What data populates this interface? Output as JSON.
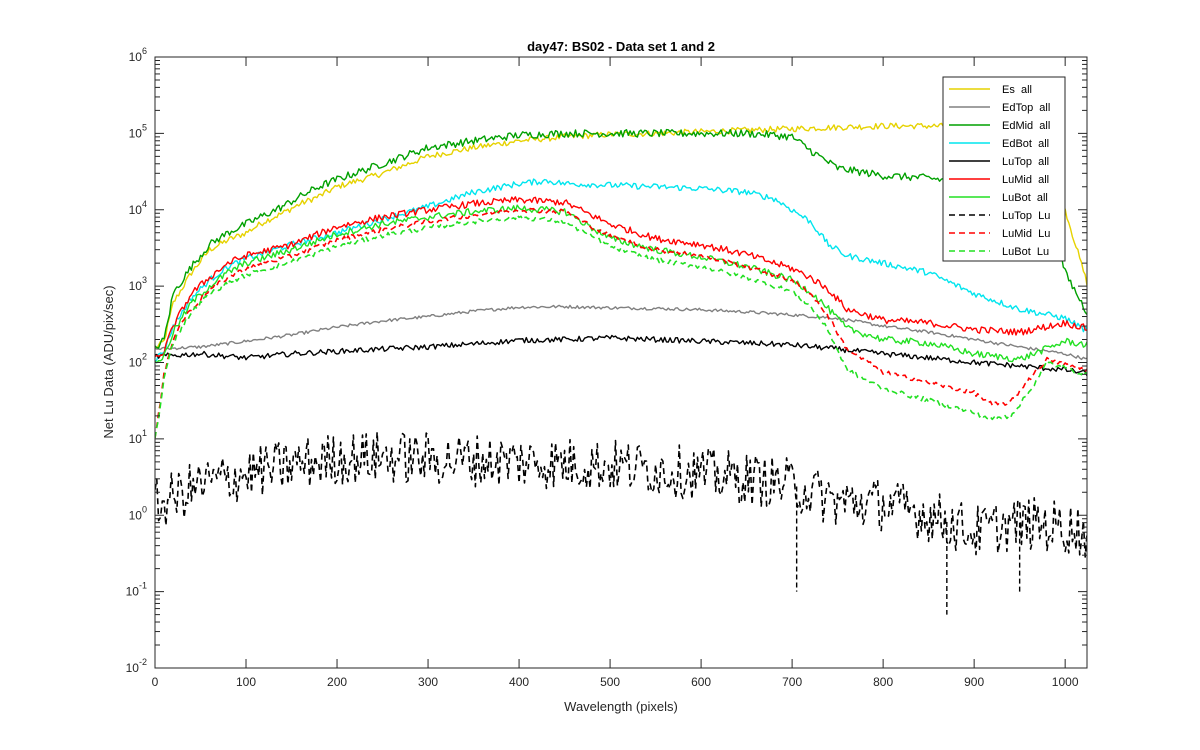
{
  "chart_data": {
    "type": "line",
    "title": "day47: BS02 - Data set 1 and 2",
    "xlabel": "Wavelength (pixels)",
    "ylabel": "Net Lu Data (ADU/pix/sec)",
    "xlim": [
      0,
      1024
    ],
    "ylim": [
      0.01,
      1000000
    ],
    "yscale": "log",
    "grid": false,
    "legend_position": "top-right",
    "x_ticks": [
      0,
      100,
      200,
      300,
      400,
      500,
      600,
      700,
      800,
      900,
      1000
    ],
    "x_tick_labels": [
      "0",
      "100",
      "200",
      "300",
      "400",
      "500",
      "600",
      "700",
      "800",
      "900",
      "1000"
    ],
    "y_ticks": [
      0.01,
      0.1,
      1,
      10,
      100,
      1000,
      10000,
      100000,
      1000000
    ],
    "y_tick_labels": [
      {
        "base": "10",
        "exp": "-2"
      },
      {
        "base": "10",
        "exp": "-1"
      },
      {
        "base": "10",
        "exp": "0"
      },
      {
        "base": "10",
        "exp": "1"
      },
      {
        "base": "10",
        "exp": "2"
      },
      {
        "base": "10",
        "exp": "3"
      },
      {
        "base": "10",
        "exp": "4"
      },
      {
        "base": "10",
        "exp": "5"
      },
      {
        "base": "10",
        "exp": "6"
      }
    ],
    "series": [
      {
        "name": "Es  all",
        "color": "#e6d200",
        "dash": "solid",
        "noise": 0.04,
        "x": [
          0,
          10,
          20,
          40,
          60,
          80,
          100,
          120,
          140,
          160,
          180,
          200,
          250,
          300,
          350,
          400,
          450,
          500,
          550,
          600,
          650,
          700,
          750,
          800,
          850,
          900,
          950,
          1000,
          1024
        ],
        "y": [
          150,
          190,
          600,
          1500,
          3000,
          4000,
          5000,
          7000,
          9000,
          12000,
          15000,
          20000,
          30000,
          50000,
          65000,
          80000,
          90000,
          97000,
          100000,
          105000,
          110000,
          115000,
          120000,
          125000,
          125000,
          122000,
          120000,
          10000,
          1100
        ]
      },
      {
        "name": "EdTop  all",
        "color": "#808080",
        "dash": "solid",
        "noise": 0.02,
        "x": [
          0,
          50,
          100,
          150,
          200,
          250,
          300,
          350,
          400,
          450,
          500,
          550,
          600,
          650,
          700,
          750,
          800,
          850,
          900,
          950,
          1000,
          1024
        ],
        "y": [
          150,
          160,
          190,
          230,
          290,
          350,
          400,
          470,
          530,
          540,
          520,
          510,
          490,
          460,
          420,
          380,
          300,
          250,
          200,
          160,
          130,
          110
        ]
      },
      {
        "name": "EdMid  all",
        "color": "#00a000",
        "dash": "solid",
        "noise": 0.05,
        "x": [
          0,
          10,
          20,
          40,
          60,
          80,
          100,
          120,
          140,
          160,
          180,
          200,
          250,
          300,
          350,
          400,
          450,
          500,
          550,
          600,
          650,
          680,
          700,
          720,
          750,
          800,
          850,
          900,
          950,
          980,
          1000,
          1024
        ],
        "y": [
          150,
          200,
          800,
          1800,
          3500,
          5000,
          6500,
          8500,
          11000,
          15000,
          20000,
          25000,
          40000,
          65000,
          80000,
          95000,
          100000,
          100000,
          100000,
          100000,
          100000,
          95000,
          90000,
          60000,
          35000,
          28000,
          26000,
          22000,
          18000,
          12000,
          1500,
          450
        ]
      },
      {
        "name": "EdBot  all",
        "color": "#00e5ee",
        "dash": "solid",
        "noise": 0.04,
        "x": [
          0,
          10,
          20,
          40,
          60,
          80,
          100,
          150,
          200,
          250,
          300,
          350,
          400,
          430,
          450,
          500,
          550,
          600,
          650,
          680,
          700,
          720,
          740,
          760,
          800,
          850,
          900,
          950,
          1000,
          1024
        ],
        "y": [
          110,
          140,
          300,
          700,
          1200,
          1800,
          2300,
          3500,
          5000,
          7500,
          11000,
          17000,
          22000,
          24000,
          22000,
          21000,
          20000,
          19000,
          17000,
          14000,
          10000,
          7000,
          3500,
          2500,
          2000,
          1500,
          800,
          500,
          380,
          260
        ]
      },
      {
        "name": "LuTop  all",
        "color": "#000000",
        "dash": "solid",
        "noise": 0.035,
        "x": [
          0,
          50,
          100,
          150,
          200,
          250,
          300,
          350,
          400,
          450,
          500,
          550,
          600,
          650,
          700,
          750,
          800,
          850,
          900,
          950,
          1000,
          1024
        ],
        "y": [
          120,
          130,
          115,
          130,
          140,
          150,
          160,
          175,
          195,
          200,
          210,
          200,
          190,
          180,
          170,
          150,
          130,
          115,
          100,
          90,
          80,
          72
        ]
      },
      {
        "name": "LuMid  all",
        "color": "#ff0000",
        "dash": "solid",
        "noise": 0.045,
        "x": [
          0,
          10,
          20,
          40,
          60,
          80,
          100,
          150,
          200,
          250,
          300,
          350,
          400,
          450,
          500,
          550,
          600,
          650,
          700,
          720,
          740,
          760,
          800,
          850,
          900,
          950,
          1000,
          1024
        ],
        "y": [
          110,
          140,
          300,
          800,
          1300,
          2000,
          2500,
          3500,
          6000,
          8000,
          10000,
          12000,
          13500,
          12500,
          6500,
          4200,
          3500,
          2600,
          1700,
          1300,
          900,
          500,
          360,
          330,
          270,
          250,
          330,
          280
        ]
      },
      {
        "name": "LuBot  all",
        "color": "#22e022",
        "dash": "solid",
        "noise": 0.045,
        "x": [
          0,
          10,
          20,
          40,
          60,
          80,
          100,
          150,
          200,
          250,
          300,
          350,
          400,
          450,
          500,
          550,
          600,
          650,
          700,
          720,
          740,
          760,
          800,
          850,
          900,
          950,
          1000,
          1024
        ],
        "y": [
          100,
          120,
          250,
          600,
          1000,
          1500,
          2000,
          3000,
          4800,
          6500,
          8000,
          9500,
          10500,
          9500,
          4200,
          3000,
          2400,
          1800,
          1200,
          850,
          500,
          280,
          200,
          180,
          130,
          110,
          190,
          170
        ]
      },
      {
        "name": "LuTop  Lu",
        "color": "#000000",
        "dash": "dashed",
        "noise": 0.35,
        "x": [
          0,
          50,
          100,
          150,
          200,
          250,
          300,
          350,
          400,
          450,
          500,
          550,
          600,
          650,
          700,
          750,
          800,
          850,
          900,
          950,
          1000,
          1024
        ],
        "y": [
          1.3,
          2.5,
          3.5,
          4.5,
          5.5,
          5.8,
          5.5,
          5.3,
          5.0,
          4.8,
          4.5,
          4.0,
          3.5,
          3.0,
          2.5,
          1.5,
          1.4,
          1.0,
          0.6,
          0.8,
          0.7,
          0.6
        ]
      },
      {
        "name": "LuMid  Lu",
        "color": "#ff0000",
        "dash": "dashed",
        "noise": 0.03,
        "x": [
          0,
          5,
          10,
          15,
          20,
          30,
          40,
          60,
          80,
          100,
          150,
          200,
          250,
          300,
          350,
          400,
          450,
          500,
          550,
          600,
          650,
          700,
          720,
          740,
          760,
          800,
          850,
          900,
          920,
          940,
          960,
          980,
          1000,
          1024
        ],
        "y": [
          10,
          25,
          70,
          130,
          200,
          350,
          500,
          900,
          1300,
          1700,
          2500,
          4000,
          5500,
          7000,
          8500,
          10000,
          9500,
          4500,
          3000,
          2500,
          1800,
          1200,
          800,
          400,
          150,
          75,
          55,
          40,
          28,
          30,
          60,
          110,
          95,
          80
        ]
      },
      {
        "name": "LuBot  Lu",
        "color": "#22e022",
        "dash": "dashed",
        "noise": 0.03,
        "x": [
          0,
          5,
          10,
          15,
          20,
          30,
          40,
          60,
          80,
          100,
          150,
          200,
          250,
          300,
          350,
          400,
          450,
          500,
          550,
          600,
          650,
          700,
          720,
          740,
          760,
          800,
          850,
          900,
          920,
          940,
          960,
          980,
          1000,
          1024
        ],
        "y": [
          10,
          22,
          60,
          120,
          180,
          300,
          450,
          800,
          1100,
          1400,
          2100,
          3300,
          4600,
          5800,
          7000,
          8000,
          7000,
          3300,
          2200,
          1800,
          1300,
          850,
          550,
          260,
          80,
          45,
          32,
          22,
          18,
          20,
          40,
          100,
          85,
          70
        ]
      }
    ],
    "series_annotations": [
      {
        "series": "LuTop  Lu",
        "x": 705,
        "y": 0.1
      },
      {
        "series": "LuTop  Lu",
        "x": 870,
        "y": 0.05
      },
      {
        "series": "LuTop  Lu",
        "x": 950,
        "y": 0.1
      }
    ]
  }
}
